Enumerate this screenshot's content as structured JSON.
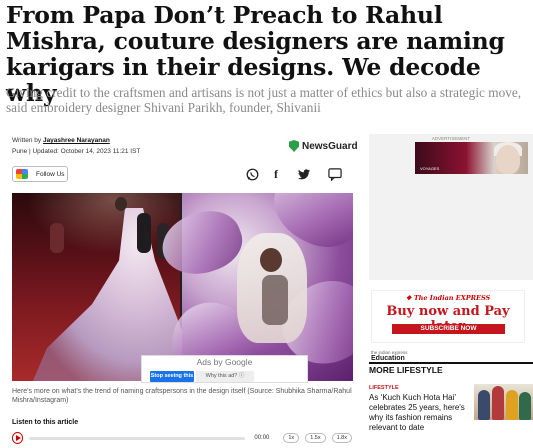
{
  "article": {
    "headline": "From Papa Don’t Preach to Rahul Mishra, couture designers are naming karigars in their designs. We decode why",
    "subheadline": "Giving credit to the craftsmen and artisans is not just a matter of ethics but also a strategic move, said embroidery designer Shivani Parikh, founder, Shivanii",
    "byline_prefix": "Written by ",
    "author": "Jayashree Narayanan",
    "dateline": "Pune | Updated: October 14, 2023 11:21 IST",
    "newsguard": "NewsGuard",
    "follow_label": "Follow Us",
    "share_icons": [
      "whatsapp-icon",
      "facebook-icon",
      "twitter-icon",
      "comment-icon"
    ],
    "image_caption": "Here's more on what's the trend of naming craftspersons in the design itself (Source: Shubhika Sharma/Rahul Mishra/Instagram)"
  },
  "ad_overlay": {
    "ads_by": "Ads by Google",
    "stop_label": "Stop seeing this ad",
    "why_label": "Why this ad? ⓘ"
  },
  "audio": {
    "listen_label": "Listen to this article",
    "time": "00:00",
    "speeds": [
      "1x",
      "1.5x",
      "1.8x"
    ]
  },
  "sidebar": {
    "advertisement_label": "ADVERTISEMENT",
    "ad_brand_text": "VOYAGES",
    "ie_brand": "❖ The Indian EXPRESS",
    "ie_cta": "Buy now and Pay later",
    "ie_subscribe": "SUBSCRIBE NOW",
    "edu_small": "the indian express",
    "edu_label": "Education",
    "more_heading": "MORE LIFESTYLE",
    "more_category": "LIFESTYLE",
    "more_title": "As ‘Kuch Kuch Hota Hai’ celebrates 25 years, here's why its fashion remains relevant to date"
  },
  "colors": {
    "accent_red": "#c4161c",
    "newsguard_green": "#2e9e4a",
    "google_blue": "#1a73e8"
  }
}
